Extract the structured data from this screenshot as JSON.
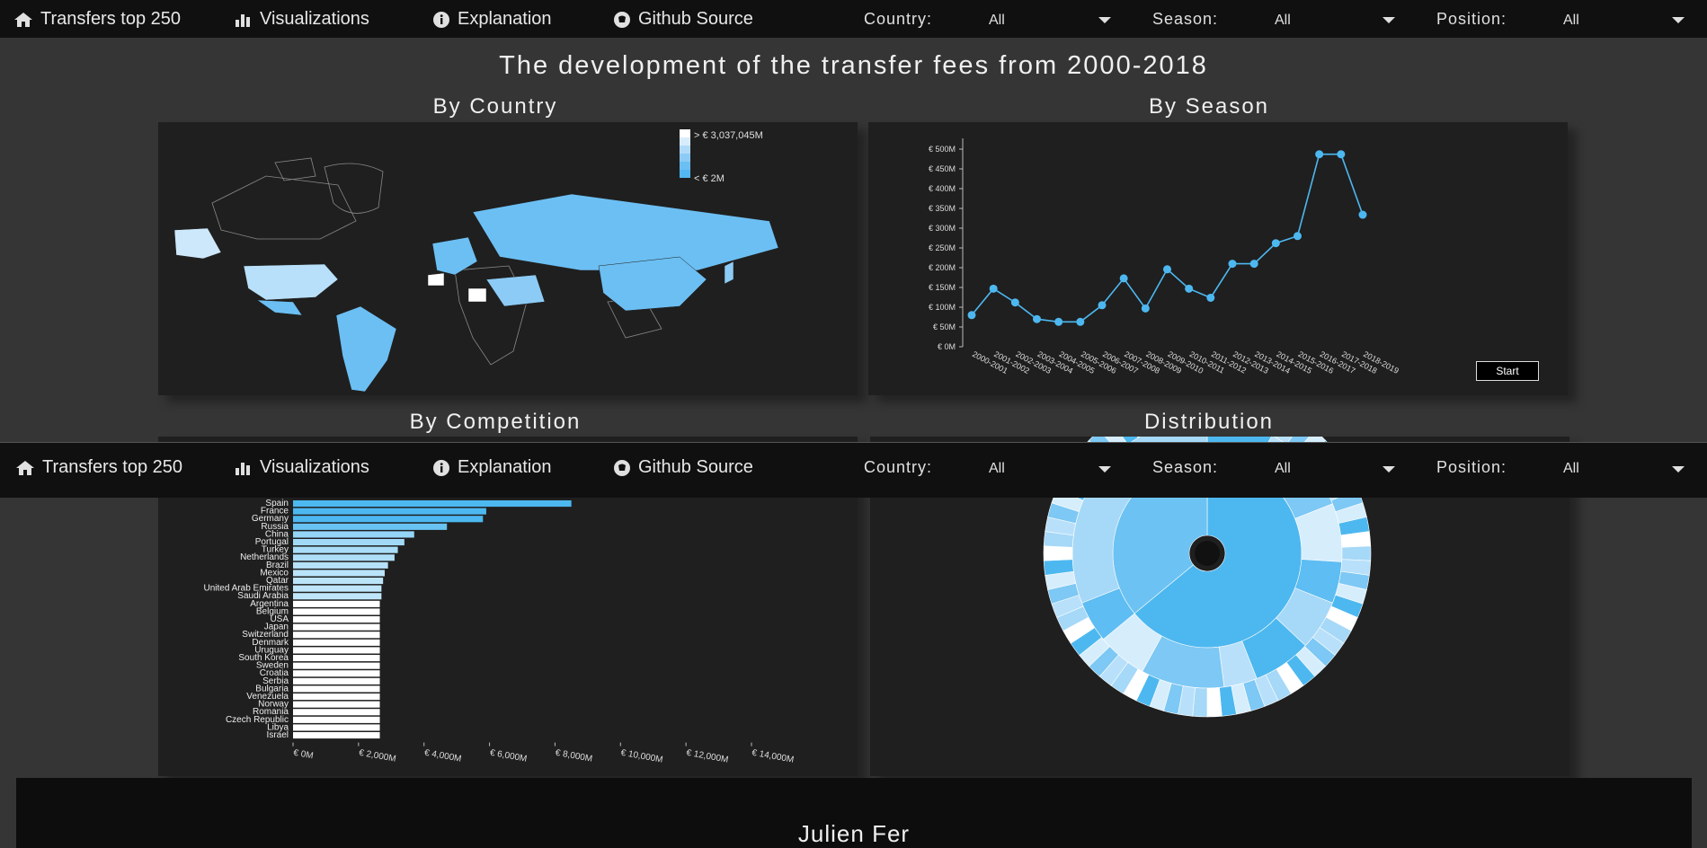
{
  "nav": {
    "items": [
      {
        "label": "Transfers top 250",
        "icon": "home-icon"
      },
      {
        "label": "Visualizations",
        "icon": "bar-chart-icon"
      },
      {
        "label": "Explanation",
        "icon": "info-icon"
      },
      {
        "label": "Github Source",
        "icon": "github-icon"
      }
    ],
    "filters": {
      "country_label": "Country:",
      "country_value": "All",
      "season_label": "Season:",
      "season_value": "All",
      "position_label": "Position:",
      "position_value": "All"
    }
  },
  "page_title": "The development of the transfer fees from 2000-2018",
  "sections": {
    "country": "By Country",
    "season": "By Season",
    "competition": "By Competition",
    "distribution": "Distribution"
  },
  "map_legend": {
    "max_label": "> € 3,037,045M",
    "min_label": "< € 2M",
    "colors": [
      "#ffffff",
      "#d8ecfb",
      "#b0daf8",
      "#8ccbf5",
      "#6cbff3",
      "#55b7f1"
    ]
  },
  "start_button": "Start",
  "footer_name": "Julien Fer",
  "colors": {
    "accent": "#4db8f0",
    "light": "#cde8fb",
    "panel": "#1f1f1f",
    "nav": "#101010"
  },
  "chart_data": [
    {
      "type": "line",
      "title": "By Season",
      "x": [
        "2000-2001",
        "2001-2002",
        "2002-2003",
        "2003-2004",
        "2004-2005",
        "2005-2006",
        "2006-2007",
        "2007-2008",
        "2008-2009",
        "2009-2010",
        "2010-2011",
        "2011-2012",
        "2012-2013",
        "2013-2014",
        "2014-2015",
        "2015-2016",
        "2016-2017",
        "2017-2018",
        "2018-2019"
      ],
      "values": [
        80,
        147,
        112,
        70,
        63,
        63,
        105,
        173,
        97,
        196,
        147,
        124,
        210,
        210,
        262,
        280,
        487,
        487,
        334
      ],
      "ylim": [
        0,
        500
      ],
      "yticks": [
        "€ 0M",
        "€ 50M",
        "€ 100M",
        "€ 150M",
        "€ 200M",
        "€ 250M",
        "€ 300M",
        "€ 350M",
        "€ 400M",
        "€ 450M",
        "€ 500M"
      ],
      "color": "#4db8f0"
    },
    {
      "type": "bar",
      "title": "By Competition",
      "orientation": "horizontal",
      "categories": [
        "Spain",
        "France",
        "Germany",
        "Russia",
        "China",
        "Portugal",
        "Turkey",
        "Netherlands",
        "Brazil",
        "Mexico",
        "Qatar",
        "United Arab Emirates",
        "Saudi Arabia",
        "Argentina",
        "Belgium",
        "USA",
        "Japan",
        "Switzerland",
        "Denmark",
        "Uruguay",
        "South Korea",
        "Sweden",
        "Croatia",
        "Serbia",
        "Bulgaria",
        "Venezuela",
        "Norway",
        "Romania",
        "Czech Republic",
        "Libya",
        "Israel"
      ],
      "values": [
        8500,
        5900,
        5800,
        4700,
        3700,
        3400,
        3200,
        3100,
        2900,
        2800,
        2750,
        2700,
        2700,
        2650,
        2650,
        2650,
        2650,
        2650,
        2650,
        2650,
        2650,
        2650,
        2650,
        2650,
        2650,
        2650,
        2650,
        2650,
        2650,
        2650,
        2650
      ],
      "xlim": [
        0,
        14000
      ],
      "xticks": [
        "€ 0M",
        "€ 2,000M",
        "€ 4,000M",
        "€ 6,000M",
        "€ 8,000M",
        "€ 10,000M",
        "€ 12,000M",
        "€ 14,000M"
      ]
    },
    {
      "type": "sunburst",
      "title": "Distribution",
      "rings": [
        {
          "name": "inner",
          "slices": [
            0.64,
            0.36
          ]
        },
        {
          "name": "middle",
          "slices": [
            0.08,
            0.05,
            0.06,
            0.07,
            0.05,
            0.06,
            0.07,
            0.04,
            0.1,
            0.06,
            0.05,
            0.31
          ]
        }
      ]
    }
  ]
}
